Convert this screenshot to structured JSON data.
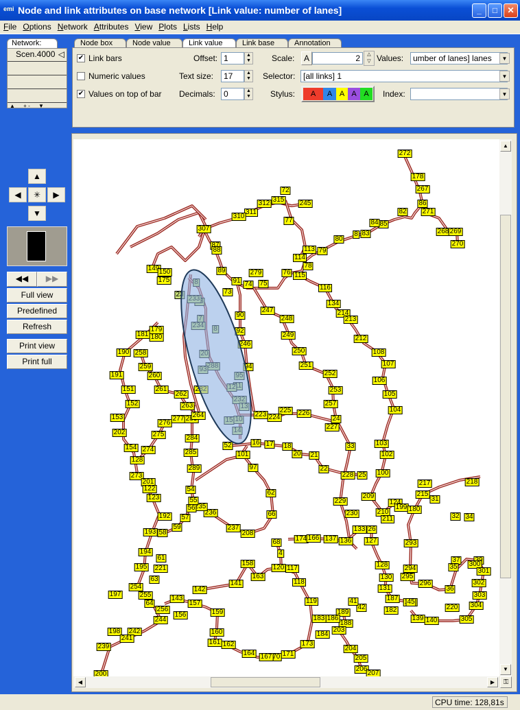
{
  "window": {
    "title": "Node and link attributes on base network [Link value: number of lanes]",
    "logo": "emi"
  },
  "menu": [
    "File",
    "Options",
    "Network",
    "Attributes",
    "View",
    "Plots",
    "Lists",
    "Help"
  ],
  "left_panel": {
    "network_tab": "Network:",
    "scenario": "Scen.4000",
    "buttons": {
      "full_view": "Full view",
      "predefined": "Predefined",
      "refresh": "Refresh",
      "print_view": "Print view",
      "print_full": "Print full"
    }
  },
  "tabs": [
    "Node box",
    "Node value",
    "Link value",
    "Link base",
    "Annotation"
  ],
  "active_tab": "Link value",
  "link_value": {
    "link_bars": {
      "label": "Link bars",
      "checked": true
    },
    "numeric_values": {
      "label": "Numeric values",
      "checked": false
    },
    "values_on_top": {
      "label": "Values on top of bar",
      "checked": true
    },
    "offset": {
      "label": "Offset:",
      "value": "1"
    },
    "text_size": {
      "label": "Text size:",
      "value": "17"
    },
    "decimals": {
      "label": "Decimals:",
      "value": "0"
    },
    "scale": {
      "label": "Scale:",
      "button": "A",
      "value": "2"
    },
    "values": {
      "label": "Values:",
      "value": "umber of lanes] lanes"
    },
    "selector": {
      "label": "Selector:",
      "value": "[all links] 1"
    },
    "stylus": {
      "label": "Stylus:",
      "swatches": [
        {
          "text": "A",
          "color": "#ee3b2b"
        },
        {
          "text": "A",
          "color": "#2f86e8"
        },
        {
          "text": "A",
          "color": "#ffff00"
        },
        {
          "text": "A",
          "color": "#9a4ee0"
        },
        {
          "text": "A",
          "color": "#22dd22"
        }
      ]
    },
    "index": {
      "label": "Index:",
      "value": ""
    }
  },
  "map": {
    "link_color": "#9b2a22",
    "label_color": "#ffff00",
    "selection_color": "#8fb2e3",
    "node_labels": [
      "272",
      "178",
      "267",
      "86",
      "271",
      "268",
      "269",
      "270",
      "82",
      "85",
      "84",
      "83",
      "8",
      "80",
      "79",
      "113",
      "114",
      "78",
      "115",
      "116",
      "134",
      "214",
      "213",
      "212",
      "108",
      "107",
      "106",
      "105",
      "104",
      "103",
      "102",
      "100",
      "245",
      "72",
      "315",
      "312",
      "311",
      "310",
      "307",
      "87",
      "88",
      "77",
      "76",
      "89",
      "91",
      "74",
      "75",
      "279",
      "73",
      "247",
      "90",
      "248",
      "92",
      "246",
      "249",
      "250",
      "251",
      "94",
      "252",
      "253",
      "257",
      "24",
      "227",
      "33",
      "226",
      "225",
      "224",
      "223",
      "16",
      "17",
      "18",
      "20",
      "21",
      "22",
      "101",
      "97",
      "52",
      "228",
      "25",
      "229",
      "230",
      "62",
      "66",
      "208",
      "237",
      "236",
      "235",
      "56",
      "55",
      "54",
      "57",
      "59",
      "58",
      "192",
      "193",
      "194",
      "61",
      "195",
      "221",
      "63",
      "254",
      "197",
      "255",
      "143",
      "157",
      "142",
      "141",
      "158",
      "163",
      "159",
      "160",
      "161",
      "162",
      "156",
      "64",
      "256",
      "244",
      "198",
      "242",
      "241",
      "239",
      "200",
      "120",
      "117",
      "118",
      "4",
      "68",
      "119",
      "173",
      "174",
      "166",
      "137",
      "136",
      "133",
      "26",
      "127",
      "128",
      "130",
      "131",
      "187",
      "185",
      "182",
      "189",
      "188",
      "186",
      "183",
      "184",
      "203",
      "204",
      "205",
      "206",
      "207",
      "171",
      "170",
      "167",
      "164",
      "209",
      "210",
      "211",
      "124",
      "199",
      "180",
      "215",
      "217",
      "31",
      "32",
      "34",
      "218",
      "293",
      "294",
      "295",
      "296",
      "36",
      "37",
      "35",
      "39",
      "300",
      "301",
      "302",
      "303",
      "304",
      "305",
      "139",
      "140",
      "220",
      "45",
      "42",
      "41",
      "149",
      "150",
      "175",
      "181",
      "179",
      "180",
      "190",
      "258",
      "259",
      "260",
      "261",
      "262",
      "263",
      "191",
      "151",
      "152",
      "153",
      "202",
      "154",
      "128",
      "273",
      "274",
      "275",
      "276",
      "277",
      "283",
      "284",
      "285",
      "289",
      "201",
      "122",
      "123",
      "282",
      "264"
    ],
    "selected_labels": [
      "8",
      "18",
      "23",
      "233",
      "7",
      "234",
      "8",
      "20",
      "288",
      "93",
      "95",
      "11",
      "12",
      "232",
      "13",
      "10",
      "15",
      "14"
    ]
  },
  "status": {
    "cpu_time": "CPU time: 128,81s"
  }
}
